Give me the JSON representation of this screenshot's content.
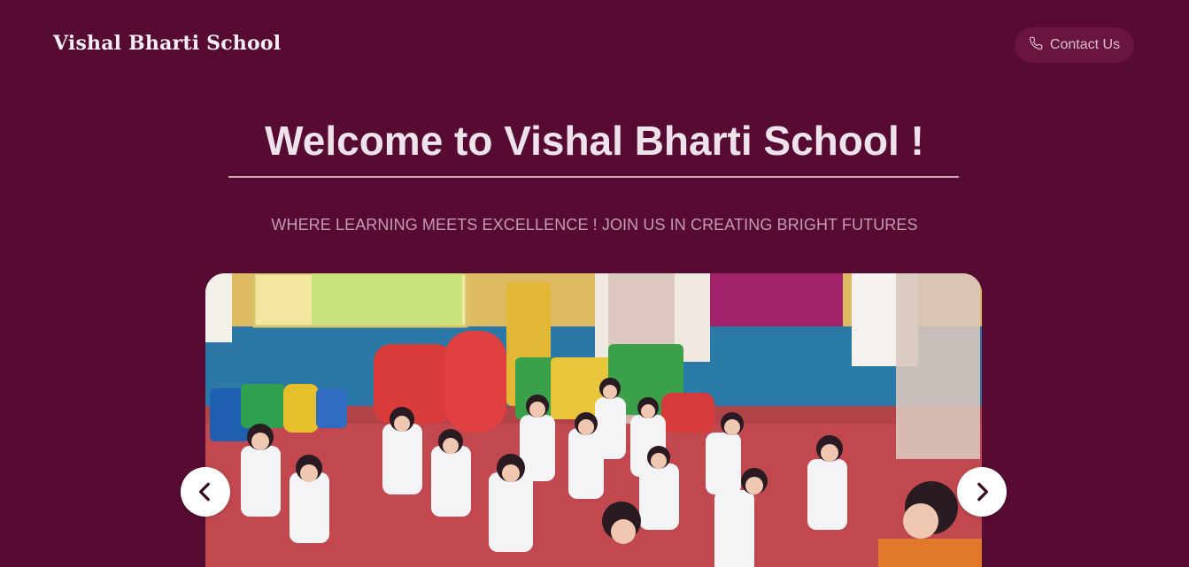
{
  "header": {
    "brand": "Vishal Bharti School",
    "contact_label": "Contact Us",
    "contact_icon": "phone-icon"
  },
  "hero": {
    "title": "Welcome to Vishal Bharti School !",
    "subtitle": "WHERE LEARNING MEETS EXCELLENCE ! JOIN US IN CREATING BRIGHT FUTURES"
  },
  "carousel": {
    "prev_icon": "chevron-left-icon",
    "next_icon": "chevron-right-icon",
    "image": "classroom-yoga-photo"
  },
  "colors": {
    "background": "#570a32",
    "button_bg": "#6a1440",
    "text_light": "#eee3ea",
    "subtitle": "#c59bb1"
  }
}
